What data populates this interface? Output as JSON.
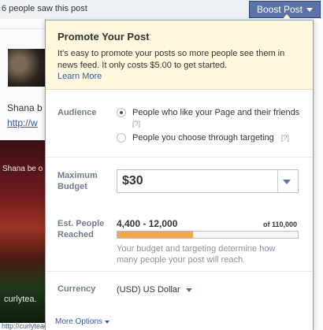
{
  "post": {
    "saw_text": "6 people saw this post",
    "author": "Shana b",
    "link": "http://w",
    "image_caption_top": "Shana be o",
    "image_caption_bottom": "curlytea.",
    "bottom_link": "http://curlyteacher.tumblr..."
  },
  "boost": {
    "label": "Boost Post"
  },
  "dialog": {
    "title": "Promote Your Post",
    "description": "It's easy to promote your posts so more people see them in news feed. It only costs $5.00 to get started.",
    "learn_more": "Learn More",
    "audience": {
      "label": "Audience",
      "options": [
        {
          "text": "People who like your Page and their friends",
          "help": "[?]",
          "selected": true
        },
        {
          "text": "People you choose through targeting",
          "help": "[?]",
          "selected": false
        }
      ]
    },
    "budget": {
      "label": "Maximum Budget",
      "value": "$30"
    },
    "reach": {
      "label": "Est. People Reached",
      "range": "4,400 - 12,000",
      "of_total": "of 110,000",
      "fill_fraction": 0.42,
      "note": "Your budget and targeting determine how many people your post will reach."
    },
    "currency": {
      "label": "Currency",
      "value": "(USD) US Dollar"
    },
    "more_options": "More Options"
  },
  "colors": {
    "accent": "#3b5998",
    "button": "#5b74a8",
    "header_bg": "#fff8dc",
    "progress_fill": "#f4a64b"
  }
}
